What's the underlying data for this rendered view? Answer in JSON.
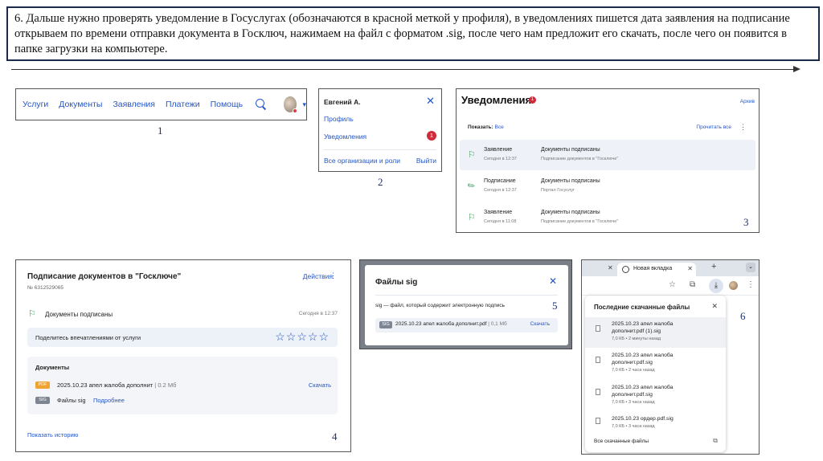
{
  "instruction": "6. Дальше нужно проверять уведомление в Госуслугах (обозначаются в красной меткой у профиля), в уведомлениях пишется дата заявления на подписание открываем по времени отправки документа в Госключ, нажимаем на файл с форматом .sig, после чего нам предложит его скачать, после чего он появится в папке загрузки на компьютере.",
  "numbers": [
    "1",
    "2",
    "3",
    "4",
    "5",
    "6"
  ],
  "panel1": {
    "nav": [
      "Услуги",
      "Документы",
      "Заявления",
      "Платежи",
      "Помощь"
    ]
  },
  "panel2": {
    "user": "Евгений А.",
    "profile": "Профиль",
    "notifications": "Уведомления",
    "badge": "1",
    "orgs": "Все организации и роли",
    "logout": "Выйти"
  },
  "panel3": {
    "title": "Уведомления",
    "badge": "1",
    "archive": "Архив",
    "show_label": "Показать:",
    "show_value": "Все",
    "read_all": "Прочитать все",
    "rows": [
      {
        "type": "Заявление",
        "time": "Сегодня в 12:37",
        "title": "Документы подписаны",
        "desc": "Подписание документов в \"Госключе\""
      },
      {
        "type": "Подписание",
        "time": "Сегодня в 12:37",
        "title": "Документы подписаны",
        "desc": "Портал Госуслуг"
      },
      {
        "type": "Заявление",
        "time": "Сегодня в 11:08",
        "title": "Документы подписаны",
        "desc": "Подписание документов в \"Госключе\""
      }
    ]
  },
  "panel4": {
    "title": "Подписание документов в \"Госключе\"",
    "id": "№ 6312529065",
    "actions": "Действия",
    "status": "Документы подписаны",
    "time": "Сегодня в 12:37",
    "feedback": "Поделитесь впечатлениями от услуги",
    "rating": 0,
    "stars": "☆☆☆☆☆",
    "docs_header": "Документы",
    "pdf_badge": "PDF",
    "pdf_name": "2025.10.23 апел жалоба дополнит",
    "pdf_size": " | 0.2 Мб",
    "download": "Скачать",
    "sig_badge": "SIG",
    "sig_files": "Файлы sig",
    "more": "Подробнее",
    "history": "Показать историю"
  },
  "panel5": {
    "title": "Файлы sig",
    "desc": "sig — файл, который содержит электронную подпись",
    "badge": "SIG",
    "file": "2025.10.23 апел жалоба дополнит.pdf",
    "size": " | 0,1 Мб",
    "download": "Скачать"
  },
  "panel6": {
    "tab": "Новая вкладка",
    "popup_title": "Последние скачанные файлы",
    "items": [
      {
        "name": "2025.10.23 апел жалоба дополнит.pdf (1).sig",
        "meta": "7,0 КБ • 2 минуты назад"
      },
      {
        "name": "2025.10.23 апел жалоба дополнит.pdf.sig",
        "meta": "7,0 КБ • 2 часа назад"
      },
      {
        "name": "2025.10.23 апел жалоба дополнит.pdf.sig",
        "meta": "7,0 КБ • 3 часа назад"
      },
      {
        "name": "2025.10.23 ордер.pdf.sig",
        "meta": "7,0 КБ • 3 часа назад"
      }
    ],
    "all": "Все скачанные файлы"
  },
  "colors": {
    "link": "#2555c7",
    "badge": "#d12a3a",
    "pdf": "#f0a330",
    "sig": "#7e8592"
  }
}
